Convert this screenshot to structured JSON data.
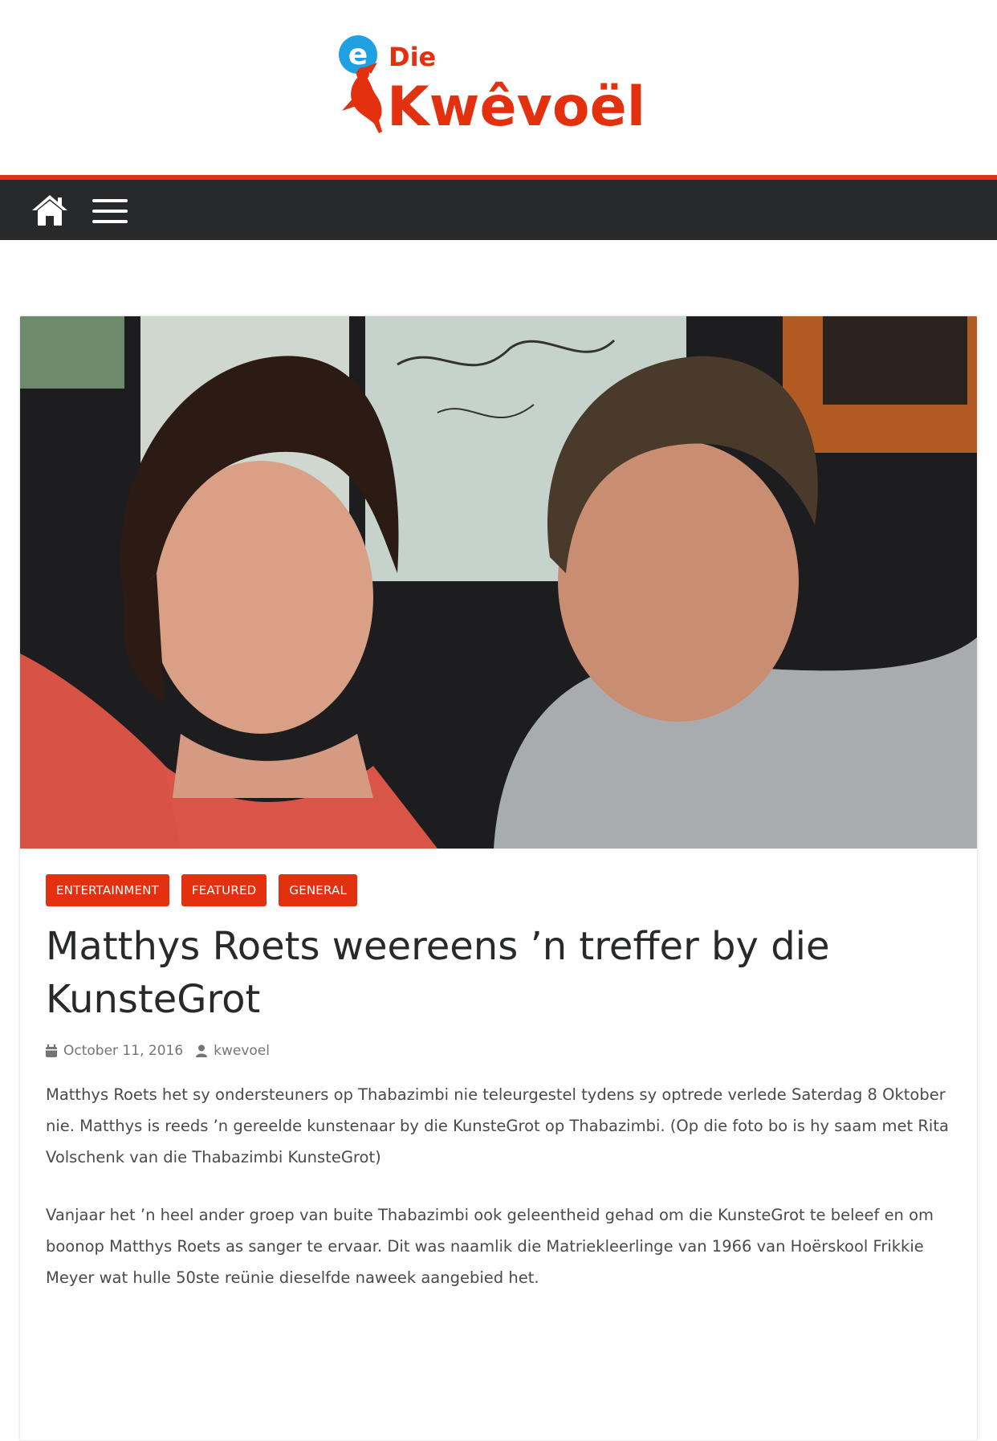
{
  "site": {
    "logo_word_small": "Die",
    "logo_word_large": "Kwêvoël",
    "logo_letter": "e",
    "brand_red": "#e3300f",
    "logo_blue": "#1fa0e0"
  },
  "nav": {
    "background": "#27292b",
    "icons": [
      "home-icon",
      "menu-icon"
    ]
  },
  "article": {
    "categories": [
      "ENTERTAINMENT",
      "FEATURED",
      "GENERAL"
    ],
    "title": "Matthys Roets weereens ’n treffer by die KunsteGrot",
    "date": "October 11, 2016",
    "author": "kwevoel",
    "paragraphs": [
      "Matthys Roets het sy ondersteuners op Thabazimbi nie teleurgestel tydens sy optrede verlede Saterdag 8 Oktober nie. Matthys is reeds ’n gereelde kunstenaar by die KunsteGrot op Thabazimbi. (Op die foto bo is hy saam met Rita Volschenk van die Thabazimbi KunsteGrot)",
      "Vanjaar het ’n heel ander groep van buite Thabazimbi ook geleentheid gehad om die KunsteGrot te beleef en om boonop Matthys Roets as sanger te ervaar. Dit was naamlik die Matriekleerlinge van 1966 van Hoërskool Frikkie Meyer wat hulle 50ste reünie dieselfde naweek aangebied het."
    ]
  }
}
